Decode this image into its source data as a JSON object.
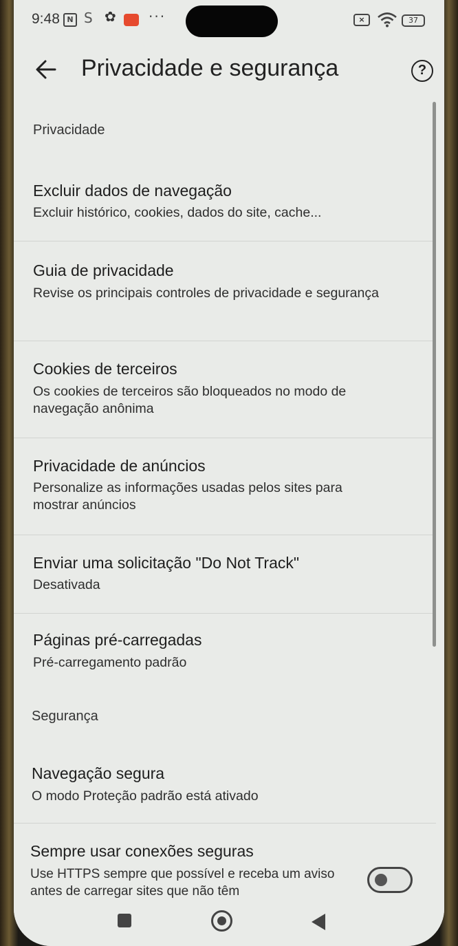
{
  "status_bar": {
    "time": "9:48",
    "nfc_label": "N",
    "s_label": "S",
    "more": "···",
    "x_label": "×",
    "battery": "37"
  },
  "header": {
    "title": "Privacidade e segurança",
    "help": "?"
  },
  "sections": {
    "privacy": "Privacidade",
    "security": "Segurança"
  },
  "items": [
    {
      "title": "Excluir dados de navegação",
      "subtitle": "Excluir histórico, cookies, dados do site, cache..."
    },
    {
      "title": "Guia de privacidade",
      "subtitle": "Revise os principais controles de privacidade e segurança"
    },
    {
      "title": "Cookies de terceiros",
      "subtitle": "Os cookies de terceiros são bloqueados no modo de navegação anônima"
    },
    {
      "title": "Privacidade de anúncios",
      "subtitle": "Personalize as informações usadas pelos sites para mostrar anúncios"
    },
    {
      "title": "Enviar uma solicitação \"Do Not Track\"",
      "subtitle": "Desativada"
    },
    {
      "title": "Páginas pré-carregadas",
      "subtitle": "Pré-carregamento padrão"
    },
    {
      "title": "Navegação segura",
      "subtitle": "O modo Proteção padrão está ativado"
    },
    {
      "title": "Sempre usar conexões seguras",
      "subtitle": "Use HTTPS sempre que possível e receba um aviso antes de carregar sites que não têm",
      "toggle_on": false
    }
  ]
}
